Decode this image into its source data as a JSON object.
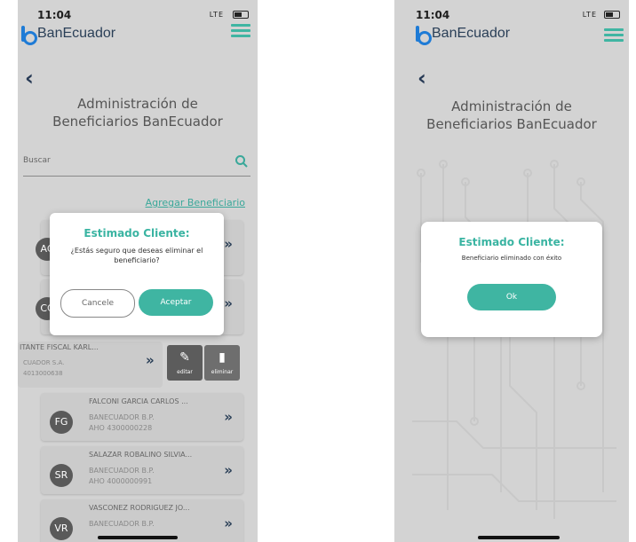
{
  "brand": {
    "name": "BanEcuador"
  },
  "colors": {
    "accent": "#3fb5a2",
    "brand_blue": "#1e7bd6",
    "dark_text": "#2a3f57"
  },
  "screen1": {
    "status": {
      "time": "11:04",
      "signal": "LTE"
    },
    "title": "Administración de Beneficiarios BanEcuador",
    "search": {
      "label": "Buscar"
    },
    "add_link": "Agregar Beneficiario",
    "cards_hidden": [
      {
        "initials": "AC"
      },
      {
        "initials": "CC"
      }
    ],
    "swiped_card": {
      "name": "ITANTE FISCAL KARL...",
      "institution": "CUADOR S.A.",
      "account": "4013000638",
      "edit_label": "editar",
      "delete_label": "eliminar"
    },
    "cards": [
      {
        "initials": "FG",
        "name": "FALCONI GARCIA CARLOS ...",
        "institution": "BANECUADOR B.P.",
        "account": "AHO 4300000228"
      },
      {
        "initials": "SR",
        "name": "SALAZAR ROBALINO SILVIA...",
        "institution": "BANECUADOR B.P.",
        "account": "AHO 4000000991"
      },
      {
        "initials": "VR",
        "name": "VASCONEZ RODRIGUEZ JO...",
        "institution": "BANECUADOR B.P.",
        "account": ""
      }
    ],
    "modal": {
      "title": "Estimado Cliente:",
      "message": "¿Estás seguro que deseas eliminar el beneficiario?",
      "cancel_label": "Cancele",
      "accept_label": "Aceptar"
    }
  },
  "screen2": {
    "status": {
      "time": "11:04",
      "signal": "LTE"
    },
    "title": "Administración de Beneficiarios BanEcuador",
    "modal": {
      "title": "Estimado Cliente:",
      "message": "Beneficiario eliminado con éxito",
      "ok_label": "Ok"
    }
  }
}
